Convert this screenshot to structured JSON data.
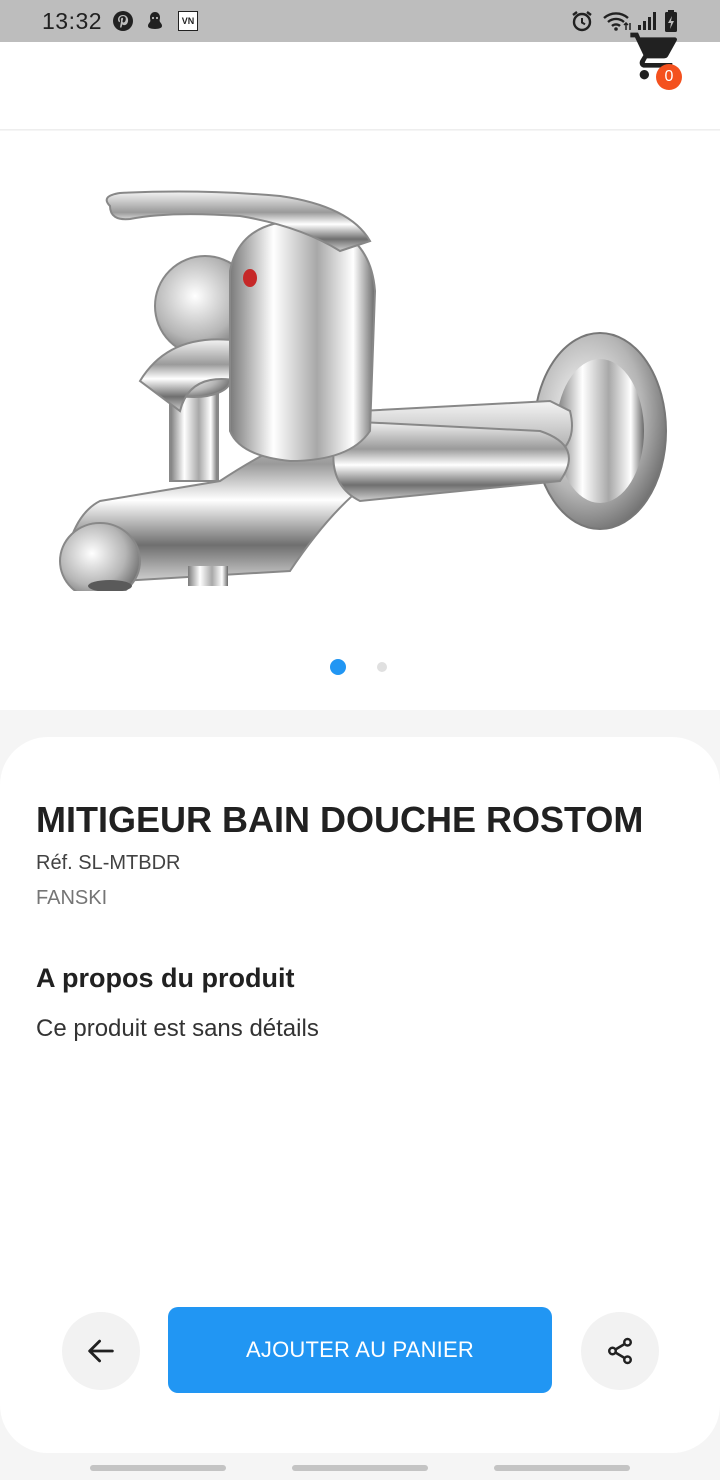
{
  "status_bar": {
    "time": "13:32",
    "icons": [
      "pinterest-icon",
      "ghost-app-icon",
      "vn-app-icon",
      "alarm-icon",
      "wifi-icon",
      "signal-icon",
      "battery-icon"
    ],
    "vn_label": "VN"
  },
  "app_bar": {
    "cart_count": "0"
  },
  "carousel": {
    "image": "mixer-faucet-image",
    "page_count": 2,
    "active_index": 0
  },
  "product": {
    "name": "MITIGEUR BAIN DOUCHE ROSTOM",
    "reference": "Réf. SL-MTBDR",
    "brand": "FANSKI",
    "about_heading": "A propos du produit",
    "about_text": "Ce produit est sans détails"
  },
  "actions": {
    "back_icon": "arrow-left-icon",
    "add_to_cart_label": "AJOUTER AU PANIER",
    "share_icon": "share-icon"
  },
  "colors": {
    "accent": "#2196f3",
    "badge": "#f4511e",
    "status_bar": "#bdbdbd"
  }
}
